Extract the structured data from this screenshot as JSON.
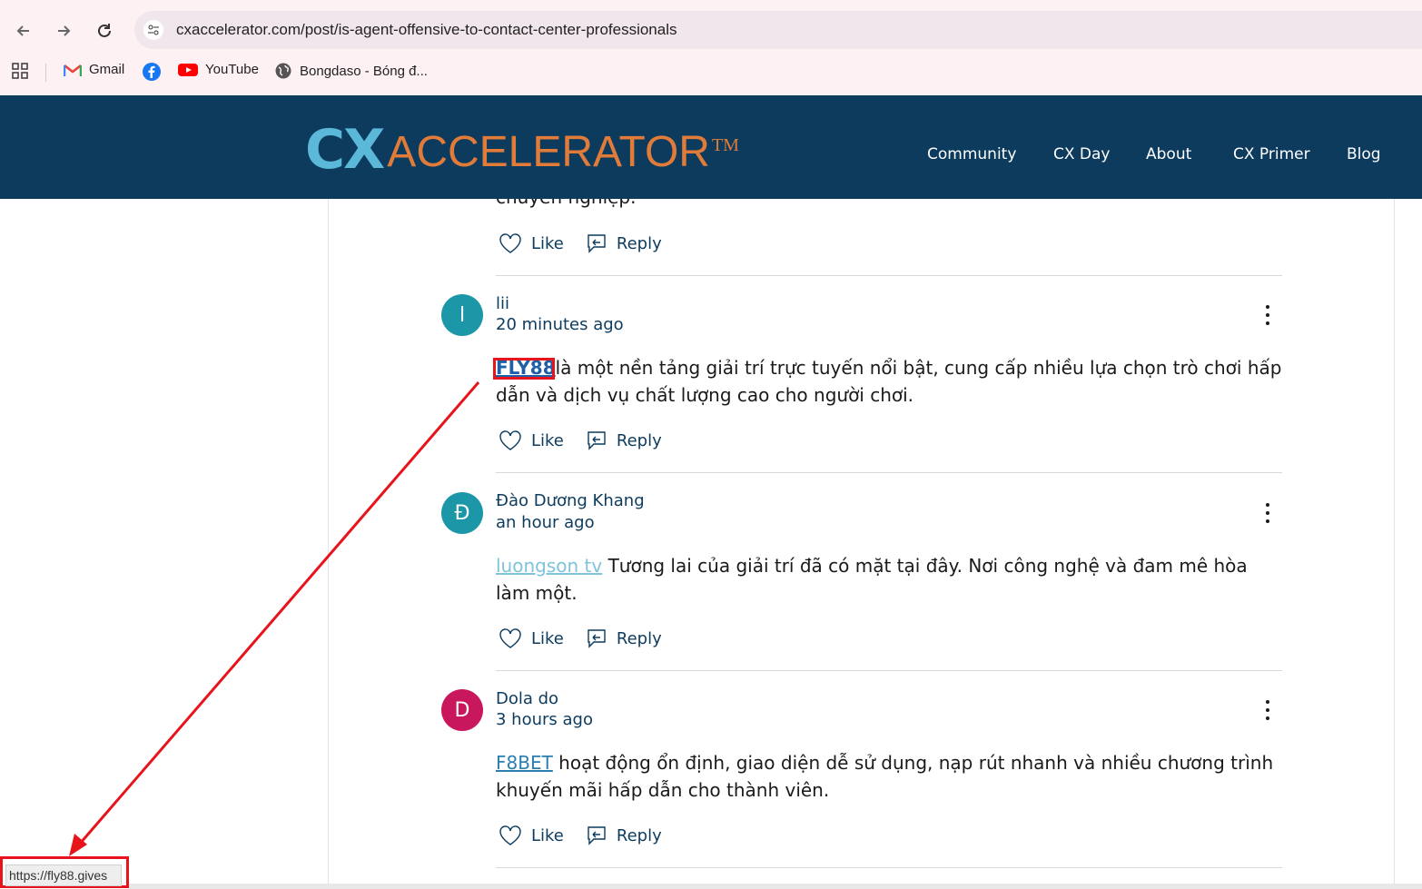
{
  "browser": {
    "url": "cxaccelerator.com/post/is-agent-offensive-to-contact-center-professionals",
    "bookmarks": [
      {
        "label": "Gmail",
        "icon": "gmail-icon"
      },
      {
        "label": "",
        "icon": "facebook-icon"
      },
      {
        "label": "YouTube",
        "icon": "youtube-icon"
      },
      {
        "label": "Bongdaso - Bóng đ...",
        "icon": "globe-icon"
      }
    ],
    "status_url": "https://fly88.gives"
  },
  "site": {
    "logo": {
      "cx": "CX",
      "accelerator": "ACCELERATOR",
      "tm": "TM"
    },
    "menu": [
      "Community",
      "CX Day",
      "About",
      "CX Primer",
      "Blog"
    ],
    "colors": {
      "header_bg": "#0c3b5e",
      "logo_blue": "#5bb8d8",
      "logo_orange": "#e07b39",
      "annotation_red": "#e8141b"
    }
  },
  "partial_comment": {
    "text": "chuyên nghiệp.",
    "like": "Like",
    "reply": "Reply"
  },
  "comments": [
    {
      "avatar_letter": "l",
      "avatar_color": "#1b97a8",
      "author": "lii",
      "time": "20 minutes ago",
      "link_text": "FLY88",
      "text_after": "là một nền tảng giải trí trực tuyến nổi bật, cung cấp nhiều lựa chọn trò chơi hấp dẫn và dịch vụ chất lượng cao cho người chơi.",
      "like": "Like",
      "reply": "Reply"
    },
    {
      "avatar_letter": "Đ",
      "avatar_color": "#1b97a8",
      "author": "Đào Dương Khang",
      "time": "an hour ago",
      "link_text": "luongson tv",
      "text_after": " Tương lai của giải trí đã có mặt tại đây. Nơi công nghệ và đam mê hòa làm một.",
      "like": "Like",
      "reply": "Reply"
    },
    {
      "avatar_letter": "D",
      "avatar_color": "#c8175d",
      "author": "Dola do",
      "time": "3 hours ago",
      "link_text": "F8BET",
      "text_after": " hoạt động ổn định, giao diện dễ sử dụng, nạp rút nhanh và nhiều chương trình khuyến mãi hấp dẫn cho thành viên.",
      "like": "Like",
      "reply": "Reply"
    }
  ]
}
